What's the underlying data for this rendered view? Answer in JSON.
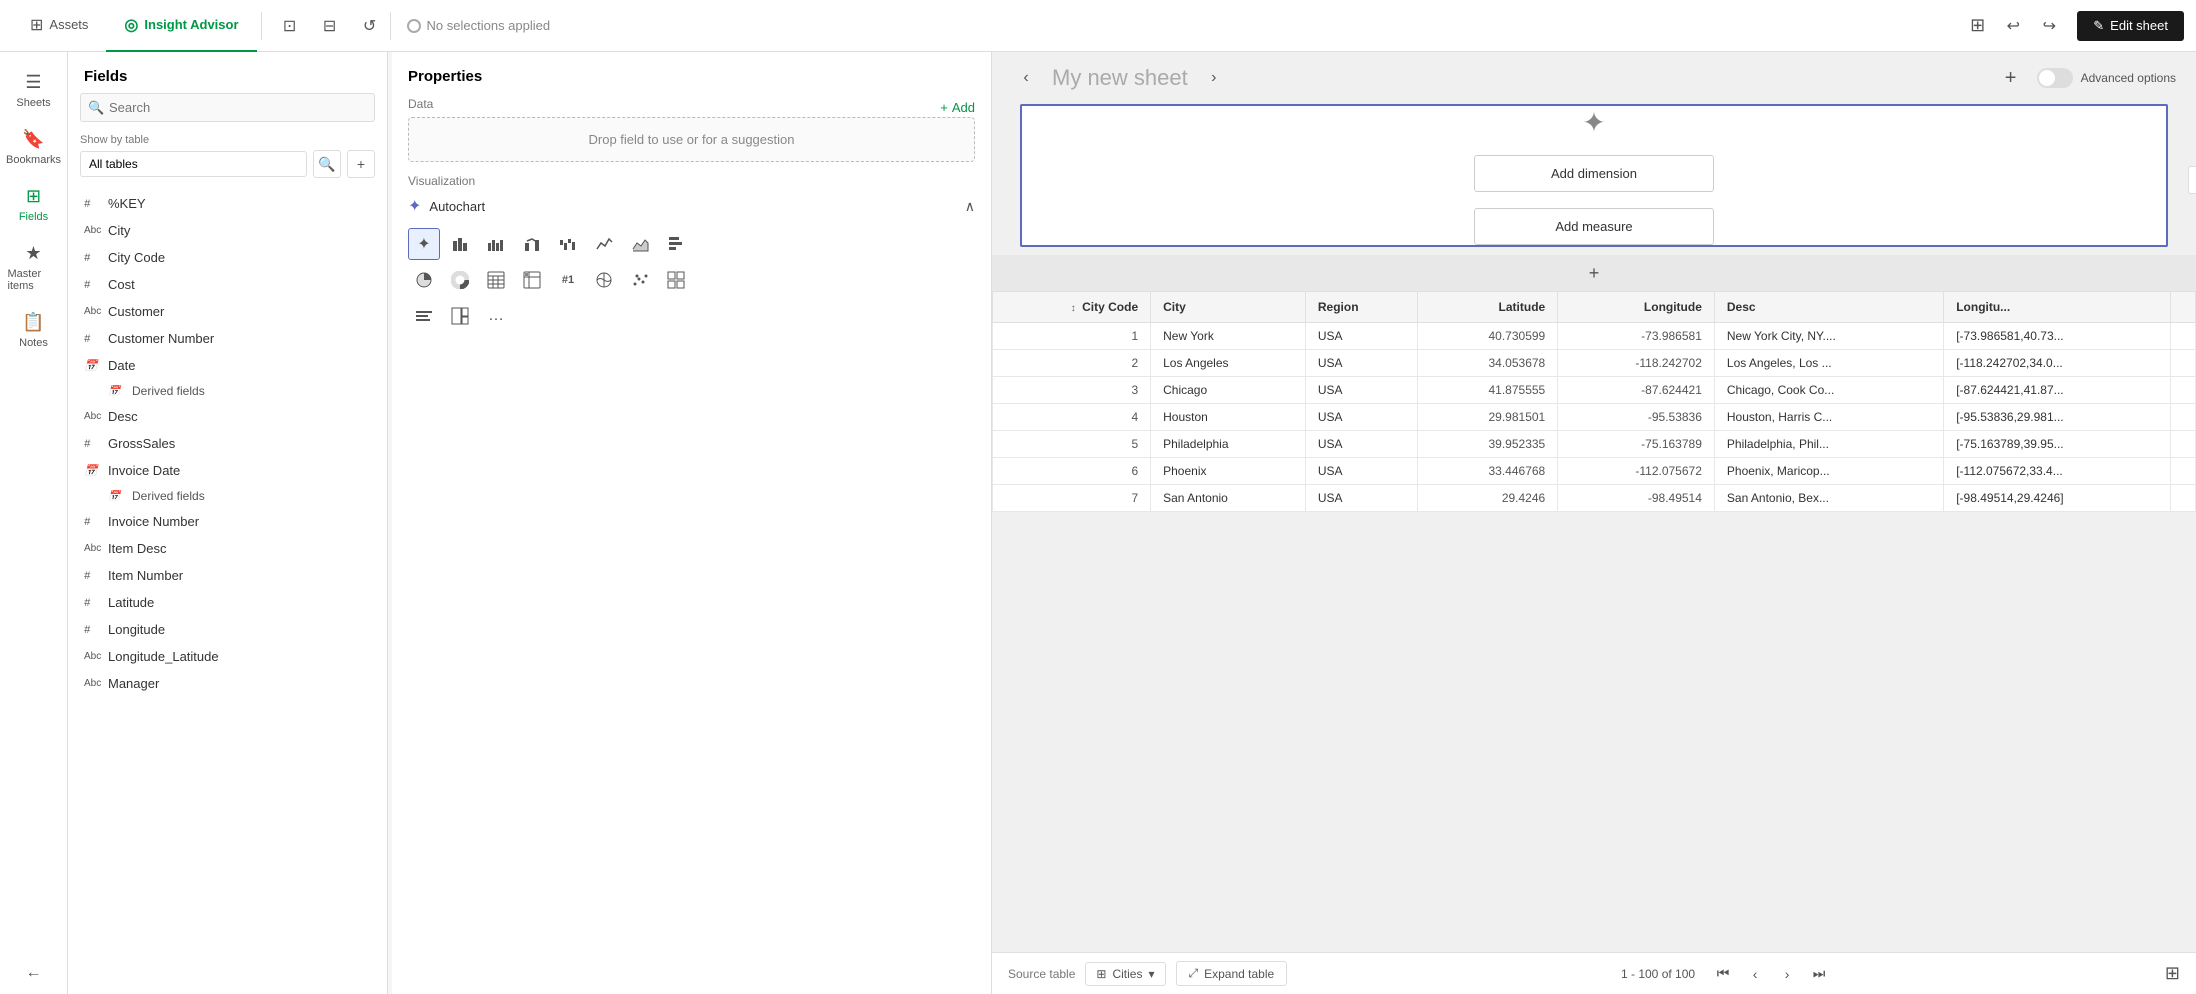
{
  "topNav": {
    "tabs": [
      {
        "id": "assets",
        "label": "Assets",
        "icon": "⊞",
        "active": false
      },
      {
        "id": "insight-advisor",
        "label": "Insight Advisor",
        "icon": "◎",
        "active": true
      }
    ],
    "tools": [
      {
        "id": "selection-tool",
        "icon": "⊡"
      },
      {
        "id": "draw-tool",
        "icon": "⊟"
      },
      {
        "id": "refresh-tool",
        "icon": "↻"
      }
    ],
    "noSelections": "No selections applied",
    "undo": "↩",
    "redo": "↪",
    "editBtn": "Edit sheet",
    "pencilIcon": "✎"
  },
  "sidebar": {
    "items": [
      {
        "id": "sheets",
        "label": "Sheets",
        "icon": "☰"
      },
      {
        "id": "bookmarks",
        "label": "Bookmarks",
        "icon": "🔖"
      },
      {
        "id": "fields",
        "label": "Fields",
        "icon": "⊞",
        "active": true
      },
      {
        "id": "master-items",
        "label": "Master items",
        "icon": "★"
      },
      {
        "id": "notes",
        "label": "Notes",
        "icon": "📋"
      }
    ],
    "collapseIcon": "←"
  },
  "fieldsPanel": {
    "title": "Fields",
    "searchPlaceholder": "Search",
    "showByTable": "Show by table",
    "tableOptions": [
      "All tables"
    ],
    "selectedTable": "All tables",
    "fields": [
      {
        "type": "#",
        "name": "%KEY"
      },
      {
        "type": "Abc",
        "name": "City"
      },
      {
        "type": "#",
        "name": "City Code"
      },
      {
        "type": "#",
        "name": "Cost"
      },
      {
        "type": "Abc",
        "name": "Customer"
      },
      {
        "type": "#",
        "name": "Customer Number"
      },
      {
        "type": "📅",
        "name": "Date"
      },
      {
        "type": "derived",
        "name": "Derived fields",
        "indent": true
      },
      {
        "type": "Abc",
        "name": "Desc"
      },
      {
        "type": "#",
        "name": "GrossSales"
      },
      {
        "type": "📅",
        "name": "Invoice Date"
      },
      {
        "type": "derived",
        "name": "Derived fields",
        "indent": true
      },
      {
        "type": "#",
        "name": "Invoice Number"
      },
      {
        "type": "Abc",
        "name": "Item Desc"
      },
      {
        "type": "#",
        "name": "Item Number"
      },
      {
        "type": "#",
        "name": "Latitude"
      },
      {
        "type": "#",
        "name": "Longitude"
      },
      {
        "type": "Abc",
        "name": "Longitude_Latitude"
      },
      {
        "type": "Abc",
        "name": "Manager"
      }
    ]
  },
  "properties": {
    "title": "Properties",
    "dataLabel": "Data",
    "addLabel": "+ Add",
    "dropZone": "Drop field to use or for a suggestion",
    "vizLabel": "Visualization",
    "autochart": "Autochart",
    "vizButtons": [
      "✏️",
      "📊",
      "📊",
      "▦",
      "▦",
      "📈",
      "📉",
      "📊",
      "🥧",
      "⏰",
      "⊞",
      "⊟",
      "#1",
      "🌐",
      "⊡",
      "⊞",
      "⬚",
      "⊟",
      "⊞",
      "…"
    ]
  },
  "sheet": {
    "title": "My new sheet",
    "addDimension": "Add dimension",
    "addMeasure": "Add measure",
    "advancedOptions": "Advanced options",
    "plusDivider": "+",
    "sideAddIcon": "+"
  },
  "table": {
    "columns": [
      {
        "id": "city-code",
        "label": "City Code",
        "sortIcon": "↕",
        "type": "num"
      },
      {
        "id": "city",
        "label": "City",
        "type": "text"
      },
      {
        "id": "region",
        "label": "Region",
        "type": "text"
      },
      {
        "id": "latitude",
        "label": "Latitude",
        "type": "num"
      },
      {
        "id": "longitude",
        "label": "Longitude",
        "type": "num"
      },
      {
        "id": "desc",
        "label": "Desc",
        "type": "text"
      },
      {
        "id": "longitu",
        "label": "Longitu...",
        "type": "text"
      }
    ],
    "rows": [
      {
        "cityCode": 1,
        "city": "New York",
        "region": "USA",
        "latitude": "40.730599",
        "longitude": "-73.986581",
        "desc": "New York City, NY....",
        "longitu": "[-73.986581,40.73..."
      },
      {
        "cityCode": 2,
        "city": "Los Angeles",
        "region": "USA",
        "latitude": "34.053678",
        "longitude": "-118.242702",
        "desc": "Los Angeles, Los ...",
        "longitu": "[-118.242702,34.0..."
      },
      {
        "cityCode": 3,
        "city": "Chicago",
        "region": "USA",
        "latitude": "41.875555",
        "longitude": "-87.624421",
        "desc": "Chicago, Cook Co...",
        "longitu": "[-87.624421,41.87..."
      },
      {
        "cityCode": 4,
        "city": "Houston",
        "region": "USA",
        "latitude": "29.981501",
        "longitude": "-95.53836",
        "desc": "Houston, Harris C...",
        "longitu": "[-95.53836,29.981..."
      },
      {
        "cityCode": 5,
        "city": "Philadelphia",
        "region": "USA",
        "latitude": "39.952335",
        "longitude": "-75.163789",
        "desc": "Philadelphia, Phil...",
        "longitu": "[-75.163789,39.95..."
      },
      {
        "cityCode": 6,
        "city": "Phoenix",
        "region": "USA",
        "latitude": "33.446768",
        "longitude": "-112.075672",
        "desc": "Phoenix, Maricop...",
        "longitu": "[-112.075672,33.4..."
      },
      {
        "cityCode": 7,
        "city": "San Antonio",
        "region": "USA",
        "latitude": "29.4246",
        "longitude": "-98.49514",
        "desc": "San Antonio, Bex...",
        "longitu": "[-98.49514,29.4246]"
      }
    ],
    "footer": {
      "sourceLabel": "Source table",
      "tableIcon": "⊞",
      "tableName": "Cities",
      "expandIcon": "⤢",
      "expandLabel": "Expand table",
      "pagination": "1 - 100 of 100"
    }
  }
}
